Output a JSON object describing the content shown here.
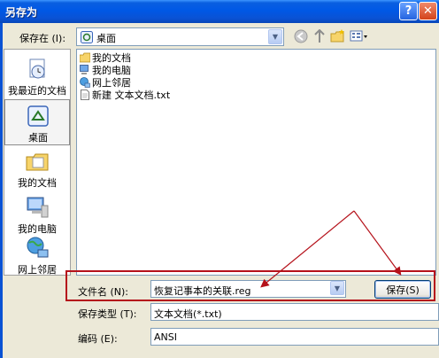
{
  "window": {
    "title": "另存为",
    "help_glyph": "?",
    "close_glyph": "✕"
  },
  "toolbar": {
    "save_in_label": "保存在 (I):",
    "save_in_value": "桌面"
  },
  "places": [
    {
      "label": "我最近的文档"
    },
    {
      "label": "桌面"
    },
    {
      "label": "我的文档"
    },
    {
      "label": "我的电脑"
    },
    {
      "label": "网上邻居"
    }
  ],
  "files": [
    {
      "name": "我的文档"
    },
    {
      "name": "我的电脑"
    },
    {
      "name": "网上邻居"
    },
    {
      "name": "新建 文本文档.txt"
    }
  ],
  "form": {
    "filename_label": "文件名 (N):",
    "filename_value": "恢复记事本的关联.reg",
    "filetype_label": "保存类型 (T):",
    "filetype_value": "文本文档(*.txt)",
    "encoding_label": "编码 (E):",
    "encoding_value": "ANSI",
    "save_button": "保存(S)"
  },
  "colors": {
    "titlebar": "#0058e6",
    "annotation": "#b5121b"
  }
}
